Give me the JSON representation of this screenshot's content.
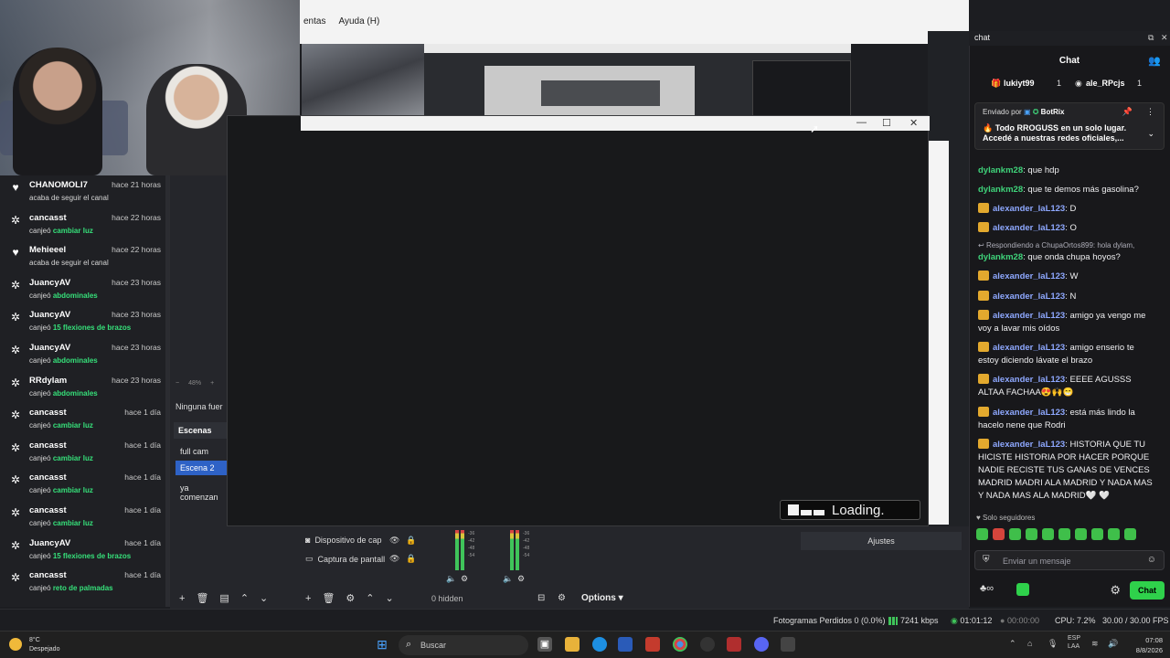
{
  "obs": {
    "menu_items": [
      "entas",
      "Ayuda (H)"
    ],
    "loading_text": "Loading.",
    "zoom": "48%",
    "no_source": "Ninguna fuer",
    "scenes_title": "Escenas",
    "scenes": [
      "full cam",
      "Escena 2",
      "ya comenzan"
    ],
    "sources": [
      "Dispositivo de cap",
      "Captura de pantall"
    ],
    "mixer_scale": [
      "-36",
      "-42",
      "-48",
      "-54"
    ],
    "hidden": "0 hidden",
    "options": "Options",
    "settings_label": "Ajustes"
  },
  "feed": [
    {
      "user": "CHANOMOLI7",
      "time": "hace 21 horas",
      "desc": "acaba de seguir el canal",
      "hl": "",
      "icon": "heart-icon"
    },
    {
      "user": "cancasst",
      "time": "hace 22 horas",
      "desc": "canjeó",
      "hl": "cambiar luz",
      "icon": "points-icon"
    },
    {
      "user": "Mehieeel",
      "time": "hace 22 horas",
      "desc": "acaba de seguir el canal",
      "hl": "",
      "icon": "heart-icon"
    },
    {
      "user": "JuancyAV",
      "time": "hace 23 horas",
      "desc": "canjeó",
      "hl": "abdominales",
      "icon": "points-icon"
    },
    {
      "user": "JuancyAV",
      "time": "hace 23 horas",
      "desc": "canjeó",
      "hl": "15 flexiones de brazos",
      "icon": "points-icon"
    },
    {
      "user": "JuancyAV",
      "time": "hace 23 horas",
      "desc": "canjeó",
      "hl": "abdominales",
      "icon": "points-icon"
    },
    {
      "user": "RRdylam",
      "time": "hace 23 horas",
      "desc": "canjeó",
      "hl": "abdominales",
      "icon": "points-icon"
    },
    {
      "user": "cancasst",
      "time": "hace 1 día",
      "desc": "canjeó",
      "hl": "cambiar luz",
      "icon": "points-icon"
    },
    {
      "user": "cancasst",
      "time": "hace 1 día",
      "desc": "canjeó",
      "hl": "cambiar luz",
      "icon": "points-icon"
    },
    {
      "user": "cancasst",
      "time": "hace 1 día",
      "desc": "canjeó",
      "hl": "cambiar luz",
      "icon": "points-icon"
    },
    {
      "user": "cancasst",
      "time": "hace 1 día",
      "desc": "canjeó",
      "hl": "cambiar luz",
      "icon": "points-icon"
    },
    {
      "user": "JuancyAV",
      "time": "hace 1 día",
      "desc": "canjeó",
      "hl": "15 flexiones de brazos",
      "icon": "points-icon"
    },
    {
      "user": "cancasst",
      "time": "hace 1 día",
      "desc": "canjeó",
      "hl": "reto de palmadas",
      "icon": "points-icon"
    }
  ],
  "status": {
    "dropped": "Fotogramas Perdidos 0 (0.0%)",
    "kbps": "7241 kbps",
    "live_time": "01:01:12",
    "rec_time": "00:00:00",
    "cpu": "CPU: 7.2%",
    "fps": "30.00 / 30.00 FPS"
  },
  "taskbar": {
    "temp": "8°C",
    "weather": "Despejado",
    "search": "Buscar",
    "lang1": "ESP",
    "lang2": "LAA",
    "time": "07:08",
    "date": "8/8/2026"
  },
  "chat": {
    "window_title": "chat",
    "header": "Chat",
    "gift_from": "lukiyt99",
    "gift_to": "ale_RPcjs",
    "gift_count": "1",
    "pinned_by_label": "Enviado por",
    "pinned_by": "BotRix",
    "pinned_msg": "Todo RROGUSS en un solo lugar. Accedé a nuestras redes oficiales,...",
    "messages": [
      {
        "user": "dylankm28",
        "text": "que hdp",
        "badge": false,
        "color": "green"
      },
      {
        "user": "dylankm28",
        "text": "que te demos más gasolina?",
        "badge": false,
        "color": "green"
      },
      {
        "user": "alexander_laL123",
        "text": "D",
        "badge": true,
        "color": "blue"
      },
      {
        "user": "alexander_laL123",
        "text": "O",
        "badge": true,
        "color": "blue"
      },
      {
        "user": "dylankm28",
        "text": "que onda chupa hoyos?",
        "badge": false,
        "color": "green"
      },
      {
        "user": "alexander_laL123",
        "text": "W",
        "badge": true,
        "color": "blue"
      },
      {
        "user": "alexander_laL123",
        "text": "N",
        "badge": true,
        "color": "blue"
      },
      {
        "user": "alexander_laL123",
        "text": "amigo ya vengo me voy a lavar mis oídos",
        "badge": true,
        "color": "blue"
      },
      {
        "user": "alexander_laL123",
        "text": "amigo enserio te estoy diciendo lávate el brazo",
        "badge": true,
        "color": "blue"
      },
      {
        "user": "alexander_laL123",
        "text": "EEEE AGUSSS ALTAA FACHAA😍🙌😁",
        "badge": true,
        "color": "blue"
      },
      {
        "user": "alexander_laL123",
        "text": "está más lindo la hacelo nene que Rodri",
        "badge": true,
        "color": "blue"
      },
      {
        "user": "alexander_laL123",
        "text": "HISTORIA QUE TU HICISTE HISTORIA POR HACER PORQUE NADIE RECISTE TUS GANAS DE VENCES MADRID MADRI ALA MADRID Y NADA MAS Y NADA MAS ALA MADRID🤍 🤍",
        "badge": true,
        "color": "blue"
      }
    ],
    "reply_text": "Respondiendo a ChupaOrtos899: hola dylam,",
    "followers_only": "Solo seguidores",
    "input_placeholder": "Enviar un mensaje",
    "send_label": "Chat"
  }
}
